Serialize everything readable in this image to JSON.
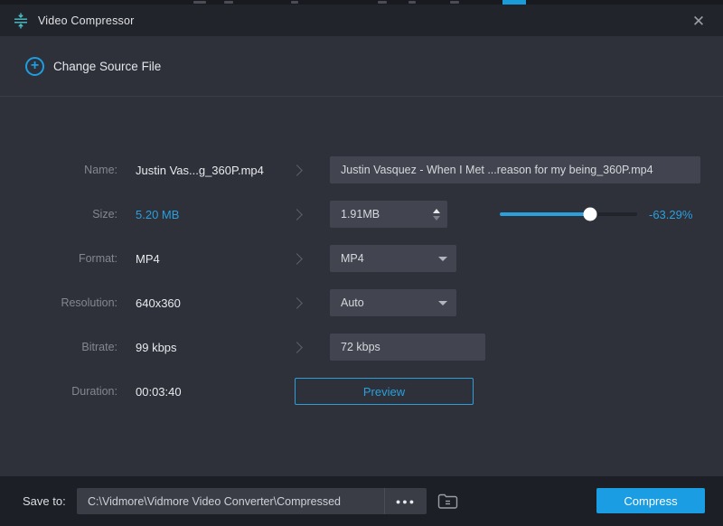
{
  "titlebar": {
    "title": "Video Compressor",
    "close_glyph": "✕"
  },
  "header": {
    "change_source_label": "Change Source File",
    "plus_glyph": "+"
  },
  "rows": {
    "name": {
      "label": "Name:",
      "value": "Justin Vas...g_360P.mp4",
      "input": "Justin Vasquez - When I Met ...reason for my being_360P.mp4"
    },
    "size": {
      "label": "Size:",
      "value": "5.20 MB",
      "input": "1.91MB",
      "percent": "-63.29%",
      "slider_position_pct": 66
    },
    "format": {
      "label": "Format:",
      "value": "MP4",
      "selected": "MP4"
    },
    "resolution": {
      "label": "Resolution:",
      "value": "640x360",
      "selected": "Auto"
    },
    "bitrate": {
      "label": "Bitrate:",
      "value": "99 kbps",
      "input": "72 kbps"
    },
    "duration": {
      "label": "Duration:",
      "value": "00:03:40",
      "button_label": "Preview"
    }
  },
  "footer": {
    "save_to_label": "Save to:",
    "path": "C:\\Vidmore\\Vidmore Video Converter\\Compressed",
    "ellipsis_glyph": "●●●",
    "compress_label": "Compress"
  },
  "colors": {
    "accent_blue": "#2aa0dc",
    "compress_button": "#1a9de2",
    "title_icon_teal": "#4cc0c8",
    "body_background": "#2e303a",
    "titlebar_background": "#22242b",
    "footer_background": "#1d1f26",
    "field_background": "#42454f"
  }
}
